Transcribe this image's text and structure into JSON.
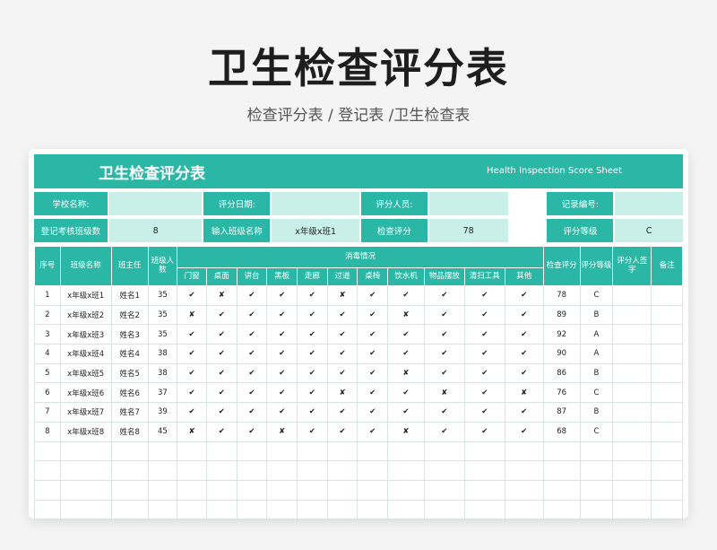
{
  "page": {
    "title": "卫生检查评分表",
    "subtitle": "检查评分表 / 登记表 /卫生检查表"
  },
  "sheet": {
    "banner_title": "卫生检查评分表",
    "banner_en": "Health Inspection Score Sheet",
    "row1": {
      "school_label": "学校名称:",
      "school_value": "",
      "date_label": "评分日期:",
      "date_value": "",
      "rater_label": "评分人员:",
      "rater_value": "",
      "record_label": "记录编号:",
      "record_value": ""
    },
    "row2": {
      "count_label": "登记考核班级数",
      "count_value": "8",
      "class_label": "输入班级名称",
      "class_value": "x年级x班1",
      "score_label": "检查评分",
      "score_value": "78",
      "grade_label": "评分等级",
      "grade_value": "C"
    },
    "headers": {
      "no": "序号",
      "class_name": "班级名称",
      "teacher": "班主任",
      "size": "班级人数",
      "disinfect": "消毒情况",
      "score": "检查评分",
      "grade": "评分等级",
      "signer": "评分人签字",
      "remark": "备注"
    },
    "items": [
      "门窗",
      "桌面",
      "讲台",
      "黑板",
      "走廊",
      "过道",
      "桌椅",
      "饮水机",
      "物品摆放",
      "清扫工具",
      "其他"
    ],
    "rows": [
      {
        "no": "1",
        "class_name": "x年级x班1",
        "teacher": "姓名1",
        "size": "35",
        "marks": [
          "✔",
          "✘",
          "✔",
          "✔",
          "✔",
          "✘",
          "✔",
          "✔",
          "✔",
          "✔",
          "✔"
        ],
        "score": "78",
        "grade": "C"
      },
      {
        "no": "2",
        "class_name": "x年级x班2",
        "teacher": "姓名2",
        "size": "35",
        "marks": [
          "✘",
          "✔",
          "✔",
          "✔",
          "✔",
          "✔",
          "✔",
          "✘",
          "✔",
          "✔",
          "✔"
        ],
        "score": "89",
        "grade": "B"
      },
      {
        "no": "3",
        "class_name": "x年级x班3",
        "teacher": "姓名3",
        "size": "35",
        "marks": [
          "✔",
          "✔",
          "✔",
          "✔",
          "✔",
          "✔",
          "✔",
          "✔",
          "✔",
          "✔",
          "✔"
        ],
        "score": "92",
        "grade": "A"
      },
      {
        "no": "4",
        "class_name": "x年级x班4",
        "teacher": "姓名4",
        "size": "38",
        "marks": [
          "✔",
          "✔",
          "✔",
          "✔",
          "✔",
          "✔",
          "✔",
          "✔",
          "✔",
          "✔",
          "✔"
        ],
        "score": "90",
        "grade": "A"
      },
      {
        "no": "5",
        "class_name": "x年级x班5",
        "teacher": "姓名5",
        "size": "38",
        "marks": [
          "✔",
          "✔",
          "✔",
          "✔",
          "✔",
          "✔",
          "✔",
          "✘",
          "✔",
          "✔",
          "✔"
        ],
        "score": "86",
        "grade": "B"
      },
      {
        "no": "6",
        "class_name": "x年级x班6",
        "teacher": "姓名6",
        "size": "37",
        "marks": [
          "✔",
          "✔",
          "✔",
          "✔",
          "✔",
          "✘",
          "✔",
          "✔",
          "✘",
          "✔",
          "✘"
        ],
        "score": "76",
        "grade": "C"
      },
      {
        "no": "7",
        "class_name": "x年级x班7",
        "teacher": "姓名7",
        "size": "39",
        "marks": [
          "✔",
          "✔",
          "✔",
          "✔",
          "✔",
          "✔",
          "✔",
          "✔",
          "✔",
          "✔",
          "✔"
        ],
        "score": "87",
        "grade": "B"
      },
      {
        "no": "8",
        "class_name": "x年级x班8",
        "teacher": "姓名8",
        "size": "45",
        "marks": [
          "✘",
          "✔",
          "✔",
          "✘",
          "✔",
          "✔",
          "✔",
          "✘",
          "✔",
          "✔",
          "✔"
        ],
        "score": "68",
        "grade": "C"
      }
    ],
    "empty_rows": 4,
    "colors": {
      "accent": "#2bb7a6",
      "light": "#c9efe9"
    }
  }
}
